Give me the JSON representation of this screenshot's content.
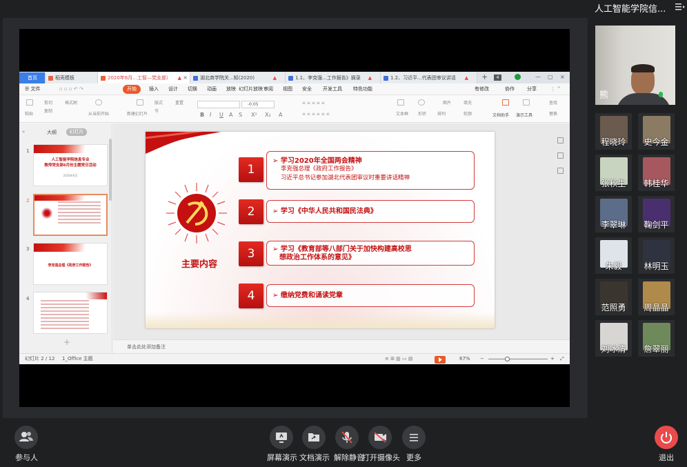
{
  "meeting": {
    "title": "人工智能学院信..."
  },
  "wps": {
    "tabs": [
      {
        "label": "首页",
        "kind": "home"
      },
      {
        "label": "稻壳模板",
        "kind": "normal"
      },
      {
        "label": "2020年6月...工智—党支部）",
        "kind": "active"
      },
      {
        "label": "湖北商学院关...知(2020)",
        "kind": "normal"
      },
      {
        "label": "1.1、李克强...工作报告》摘录",
        "kind": "normal"
      },
      {
        "label": "1.2、习近平...代表团审议讲话",
        "kind": "normal"
      }
    ],
    "tab_count": "4",
    "menu": [
      "文件",
      "开始",
      "插入",
      "设计",
      "切换",
      "动画",
      "放映",
      "幻灯片放映",
      "审阅",
      "视图",
      "安全",
      "开发工具",
      "特色功能"
    ],
    "menu_right": [
      "有修改",
      "协作",
      "分享"
    ],
    "ribbon": {
      "paste": "粘贴",
      "cut": "剪切",
      "copy": "复制",
      "format_painter": "格式刷",
      "play_from_current": "从当前开始",
      "new_slide": "新建幻灯片",
      "layout": "版式",
      "section": "节",
      "reset": "重置",
      "font_size": "-0.05",
      "text_box": "文本框",
      "shape": "形状",
      "arrange": "排列",
      "picture": "图片",
      "fill": "填充",
      "outline": "轮廓",
      "doc_assistant": "文档助手",
      "presentation_tools": "演示工具",
      "find": "查找",
      "replace": "替换"
    },
    "thumb_pane": {
      "tab_outline": "大纲",
      "tab_slides": "幻灯片",
      "slides": [
        {
          "num": "1",
          "title": "人工智能学院信息专业\n教师党支部6月份主题党日活动",
          "sub": "2020年6月"
        },
        {
          "num": "2",
          "title": "",
          "sub": ""
        },
        {
          "num": "3",
          "title": "李克强总理《政府工作报告》",
          "sub": ""
        },
        {
          "num": "4",
          "title": "",
          "sub": ""
        }
      ]
    },
    "slide": {
      "heading": "主要内容",
      "items": [
        {
          "num": "1",
          "main": "学习2020年全国两会精神",
          "subs": [
            "李克强总理《政府工作报告》",
            "习近平总书记参加湖北代表团审议时重要讲话精神"
          ]
        },
        {
          "num": "2",
          "main": "学习《中华人民共和国民法典》",
          "subs": []
        },
        {
          "num": "3",
          "main": "学习《教育部等八部门关于加快构建高校思",
          "subs": [
            "想政治工作体系的意见》"
          ]
        },
        {
          "num": "4",
          "main": "缴纳党费和诵读党章",
          "subs": []
        }
      ]
    },
    "notes_placeholder": "单击此处添加备注",
    "status": {
      "slide_pos": "幻灯片 2 / 12",
      "theme": "1_Office 主题",
      "zoom": "67%"
    }
  },
  "participants": {
    "presenter": "熊",
    "list": [
      {
        "name": "程晓玲",
        "color": "#6b5a4e"
      },
      {
        "name": "史今金",
        "color": "#8c7b63"
      },
      {
        "name": "张秋生",
        "color": "#c9d4c0"
      },
      {
        "name": "韩桂华",
        "color": "#a7585e"
      },
      {
        "name": "李翠琳",
        "color": "#5c6d8a"
      },
      {
        "name": "鞠剑平",
        "color": "#4a2f6e"
      },
      {
        "name": "朱毅",
        "color": "#dfe4ea"
      },
      {
        "name": "林明玉",
        "color": "#2f3340"
      },
      {
        "name": "范照勇",
        "color": "#3b3530"
      },
      {
        "name": "周晶晶",
        "color": "#b08a4a"
      },
      {
        "name": "刘冰清",
        "color": "#d8d6d2"
      },
      {
        "name": "詹翠丽",
        "color": "#6f8a5a"
      }
    ]
  },
  "toolbar": {
    "participants": "参与人",
    "screen_share": "屏幕演示",
    "doc_share": "文档演示",
    "unmute": "解除静音",
    "camera": "打开摄像头",
    "more": "更多",
    "exit": "退出"
  },
  "colors": {
    "accent_red": "#c41010",
    "exit_red": "#e94b4b",
    "wps_orange": "#e85a2a"
  }
}
